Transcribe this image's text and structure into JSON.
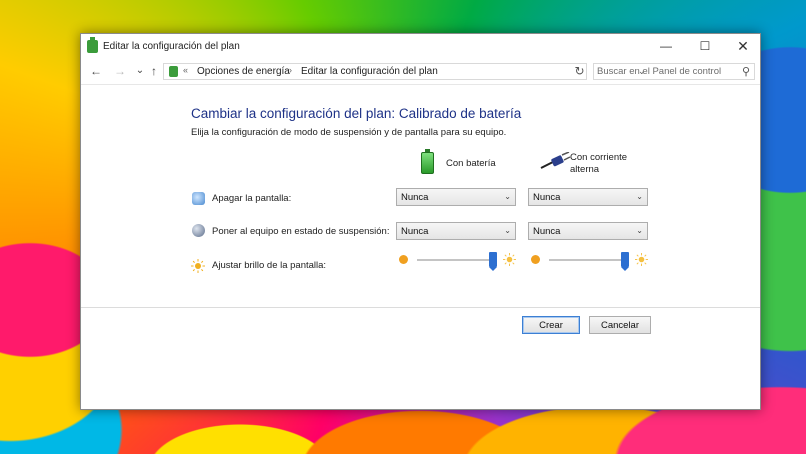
{
  "window": {
    "title": "Editar la configuración del plan",
    "minimize_glyph": "—",
    "maximize_glyph": "☐",
    "close_glyph": "✕"
  },
  "nav": {
    "back_glyph": "←",
    "forward_glyph": "→",
    "history_glyph": "⌄",
    "up_glyph": "↑",
    "separator_glyph": "«",
    "crumb_separator_glyph": "›",
    "breadcrumbs": [
      "Opciones de energía",
      "Editar la configuración del plan"
    ],
    "dropdown_glyph": "⌄",
    "refresh_glyph": "↻",
    "search_placeholder": "Buscar en el Panel de control",
    "search_glyph": "⚲"
  },
  "content": {
    "heading": "Cambiar la configuración del plan: Calibrado de batería",
    "subheading": "Elija la configuración de modo de suspensión y de pantalla para su equipo.",
    "columns": {
      "battery": "Con batería",
      "plugged": "Con corriente alterna"
    },
    "rows": {
      "display_off": {
        "label": "Apagar la pantalla:",
        "battery_value": "Nunca",
        "plugged_value": "Nunca"
      },
      "sleep": {
        "label": "Poner al equipo en estado de suspensión:",
        "battery_value": "Nunca",
        "plugged_value": "Nunca"
      },
      "brightness": {
        "label": "Ajustar brillo de la pantalla:",
        "battery_level": 1.0,
        "plugged_level": 1.0
      }
    },
    "select_arrow_glyph": "⌄"
  },
  "buttons": {
    "create": "Crear",
    "cancel": "Cancelar"
  },
  "colors": {
    "heading": "#1e3287",
    "slider_thumb": "#2c6fd1",
    "battery_green": "#2a9a2a"
  },
  "icons": [
    "power-options-icon",
    "battery-icon",
    "power-plug-icon",
    "monitor-icon",
    "sleep-moon-icon",
    "brightness-sun-icon",
    "search-icon",
    "refresh-icon"
  ]
}
